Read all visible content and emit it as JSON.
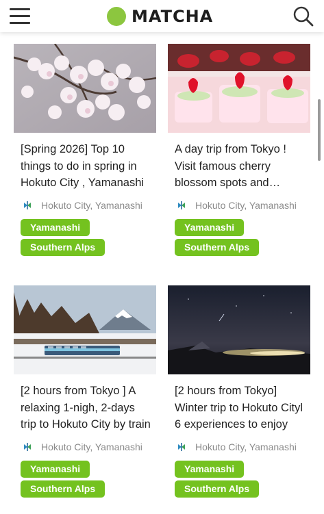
{
  "header": {
    "logo_text": "MATCHA",
    "brand_color": "#8cc63f",
    "menu_icon": "hamburger-menu-icon",
    "search_icon": "search-icon"
  },
  "tag_color": "#74c21f",
  "articles": [
    {
      "title": "[Spring 2026] Top 10 things to do in spring in Hokuto City , Yamanashi",
      "location": "Hokuto City, Yamanashi",
      "tags": [
        "Yamanashi",
        "Southern Alps"
      ],
      "image": "cherry-blossoms-photo"
    },
    {
      "title": "A day trip from Tokyo ! Visit famous cherry blossom spots and strawberry sweets",
      "location": "Hokuto City, Yamanashi",
      "tags": [
        "Yamanashi",
        "Southern Alps"
      ],
      "image": "strawberry-cakes-photo"
    },
    {
      "title": "[2 hours from Tokyo ] A relaxing 1-nigh, 2-days trip to Hokuto City by train",
      "location": "Hokuto City, Yamanashi",
      "tags": [
        "Yamanashi",
        "Southern Alps"
      ],
      "image": "train-mount-fuji-photo"
    },
    {
      "title": "[2 hours from Tokyo] Winter trip to Hokuto Cityl 6 experiences to enjoy",
      "location": "Hokuto City, Yamanashi",
      "tags": [
        "Yamanashi",
        "Southern Alps"
      ],
      "image": "night-sky-photo"
    }
  ]
}
